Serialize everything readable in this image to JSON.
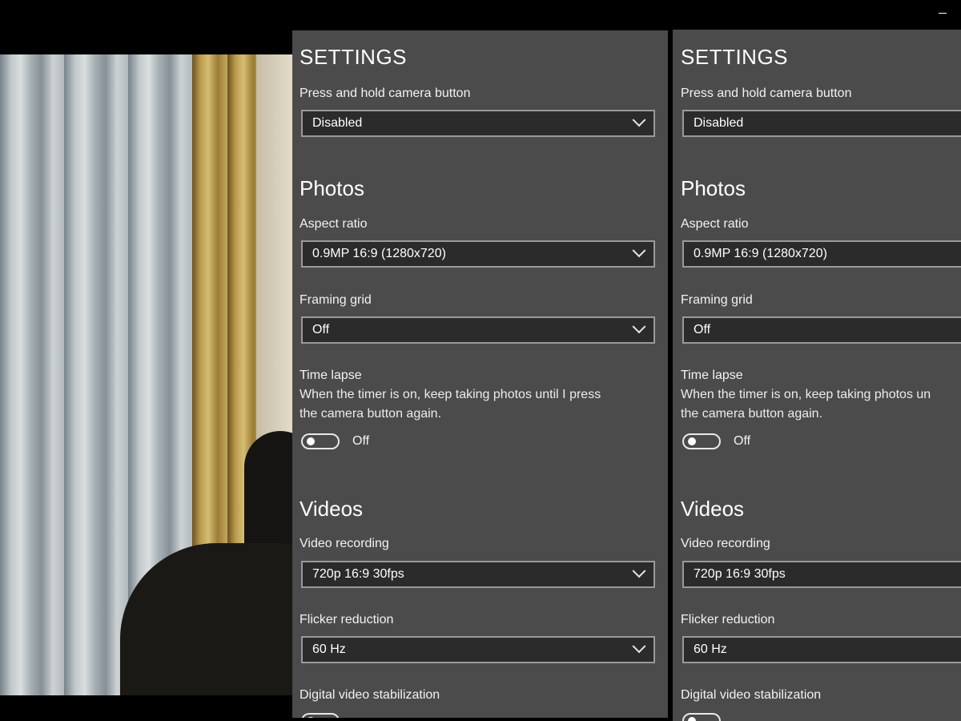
{
  "settings": {
    "title": "SETTINGS",
    "press_hold_label": "Press and hold camera button",
    "press_hold_value": "Disabled",
    "photos_title": "Photos",
    "aspect_label": "Aspect ratio",
    "aspect_value": "0.9MP 16:9 (1280x720)",
    "grid_label": "Framing grid",
    "grid_value": "Off",
    "timelapse_label": "Time lapse",
    "timelapse_desc_a": "When the timer is on, keep taking photos until I press",
    "timelapse_desc_b": "the camera button again.",
    "timelapse_desc_a_clipped": "When the timer is on, keep taking photos un",
    "timelapse_state": "Off",
    "videos_title": "Videos",
    "video_rec_label": "Video recording",
    "video_rec_value": "720p 16:9 30fps",
    "flicker_label": "Flicker reduction",
    "flicker_value": "60 Hz",
    "stabilization_label": "Digital video stabilization"
  }
}
